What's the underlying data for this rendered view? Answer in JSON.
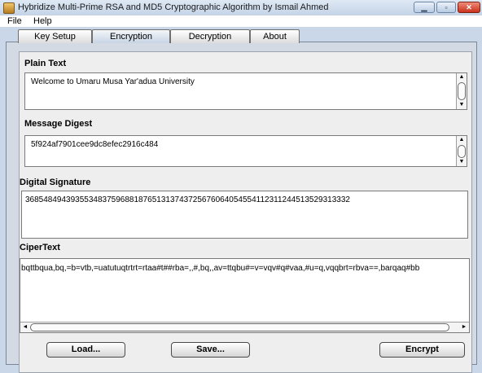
{
  "window": {
    "title": "Hybridize Multi-Prime RSA and MD5 Cryptographic Algorithm by Ismail Ahmed"
  },
  "menu": [
    "File",
    "Help"
  ],
  "tabs": [
    {
      "label": "Key Setup"
    },
    {
      "label": "Encryption",
      "active": true
    },
    {
      "label": "Decryption"
    },
    {
      "label": "About"
    }
  ],
  "plain_text": {
    "label": "Plain Text",
    "value": "Welcome to Umaru Musa Yar'adua University"
  },
  "message_digest": {
    "label": "Message Digest",
    "value": "5f924af7901cee9dc8efec2916c484"
  },
  "digital_signature": {
    "label": "Digital Signature",
    "value": "368548494393553483759688187651313743725676064054554112311244513529313332"
  },
  "cipher_text": {
    "label": "CiperText",
    "value": "bqttbqua,bq,=b=vtb,=uatutuqtrtrt=rtaa#t##rba=,,#,bq,,av=ttqbu#=v=vqv#q#vaa,#u=q,vqqbrt=rbva==,barqaq#bb"
  },
  "buttons": {
    "load": "Load...",
    "save": "Save...",
    "encrypt": "Encrypt"
  },
  "icons": {
    "app": "app-icon",
    "minimize": "minimize-icon",
    "maximize": "maximize-icon",
    "close": "close-icon"
  },
  "colors": {
    "close_button": "#c9321b",
    "panel_bg": "#d3dae4"
  }
}
